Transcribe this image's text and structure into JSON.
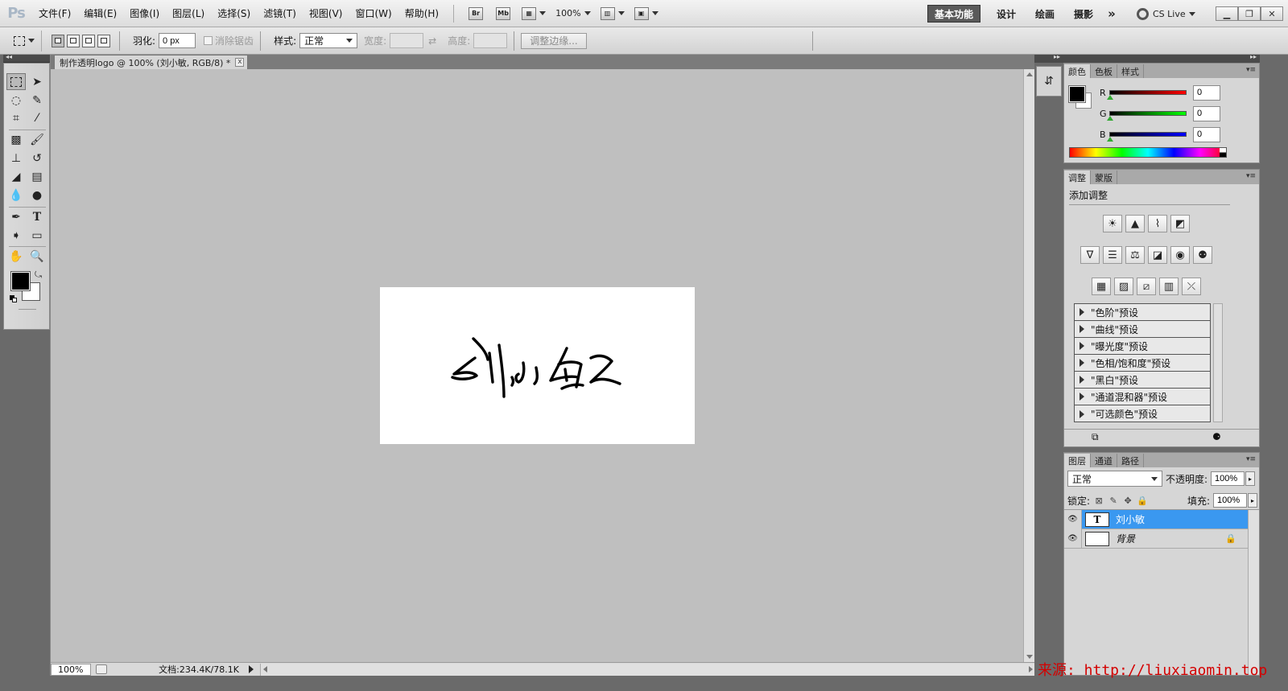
{
  "app": {
    "logo": "Ps"
  },
  "menu": [
    "文件(F)",
    "编辑(E)",
    "图像(I)",
    "图层(L)",
    "选择(S)",
    "滤镜(T)",
    "视图(V)",
    "窗口(W)",
    "帮助(H)"
  ],
  "appbar": {
    "bridge": "Br",
    "minibridge": "Mb",
    "zoom": "100%"
  },
  "workspaces": {
    "active": "基本功能",
    "design": "设计",
    "paint": "绘画",
    "photo": "摄影",
    "more": "»"
  },
  "cslive": "CS Live",
  "options": {
    "feather_label": "羽化:",
    "feather_value": "0 px",
    "antialias_label": "消除锯齿",
    "style_label": "样式:",
    "style_value": "正常",
    "width_label": "宽度:",
    "height_label": "高度:",
    "refine_button": "调整边缘..."
  },
  "document": {
    "tab_title": "制作透明logo @ 100% (刘小敏, RGB/8) *",
    "close": "x",
    "signature": "刘小敏"
  },
  "status": {
    "zoom": "100%",
    "doc_info": "文档:234.4K/78.1K"
  },
  "colors": {
    "selected_layer": "#3a98f0",
    "foreground": "#000000",
    "background": "#ffffff",
    "watermark": "#d40000"
  },
  "color_panel": {
    "tabs": [
      "颜色",
      "色板",
      "样式"
    ],
    "r_label": "R",
    "g_label": "G",
    "b_label": "B",
    "r": "0",
    "g": "0",
    "b": "0"
  },
  "adjust_panel": {
    "tabs": [
      "调整",
      "蒙版"
    ],
    "title": "添加调整",
    "presets": [
      "\"色阶\"预设",
      "\"曲线\"预设",
      "\"曝光度\"预设",
      "\"色相/饱和度\"预设",
      "\"黑白\"预设",
      "\"通道混和器\"预设",
      "\"可选颜色\"预设"
    ]
  },
  "layers_panel": {
    "tabs": [
      "图层",
      "通道",
      "路径"
    ],
    "blend_mode": "正常",
    "opacity_label": "不透明度:",
    "opacity": "100%",
    "lock_label": "锁定:",
    "fill_label": "填充:",
    "fill": "100%",
    "layers": [
      {
        "name": "刘小敏",
        "type": "text-layer",
        "selected": true
      },
      {
        "name": "背景",
        "type": "background-layer",
        "selected": false
      }
    ]
  },
  "watermark": "来源: http://liuxiaomin.top"
}
